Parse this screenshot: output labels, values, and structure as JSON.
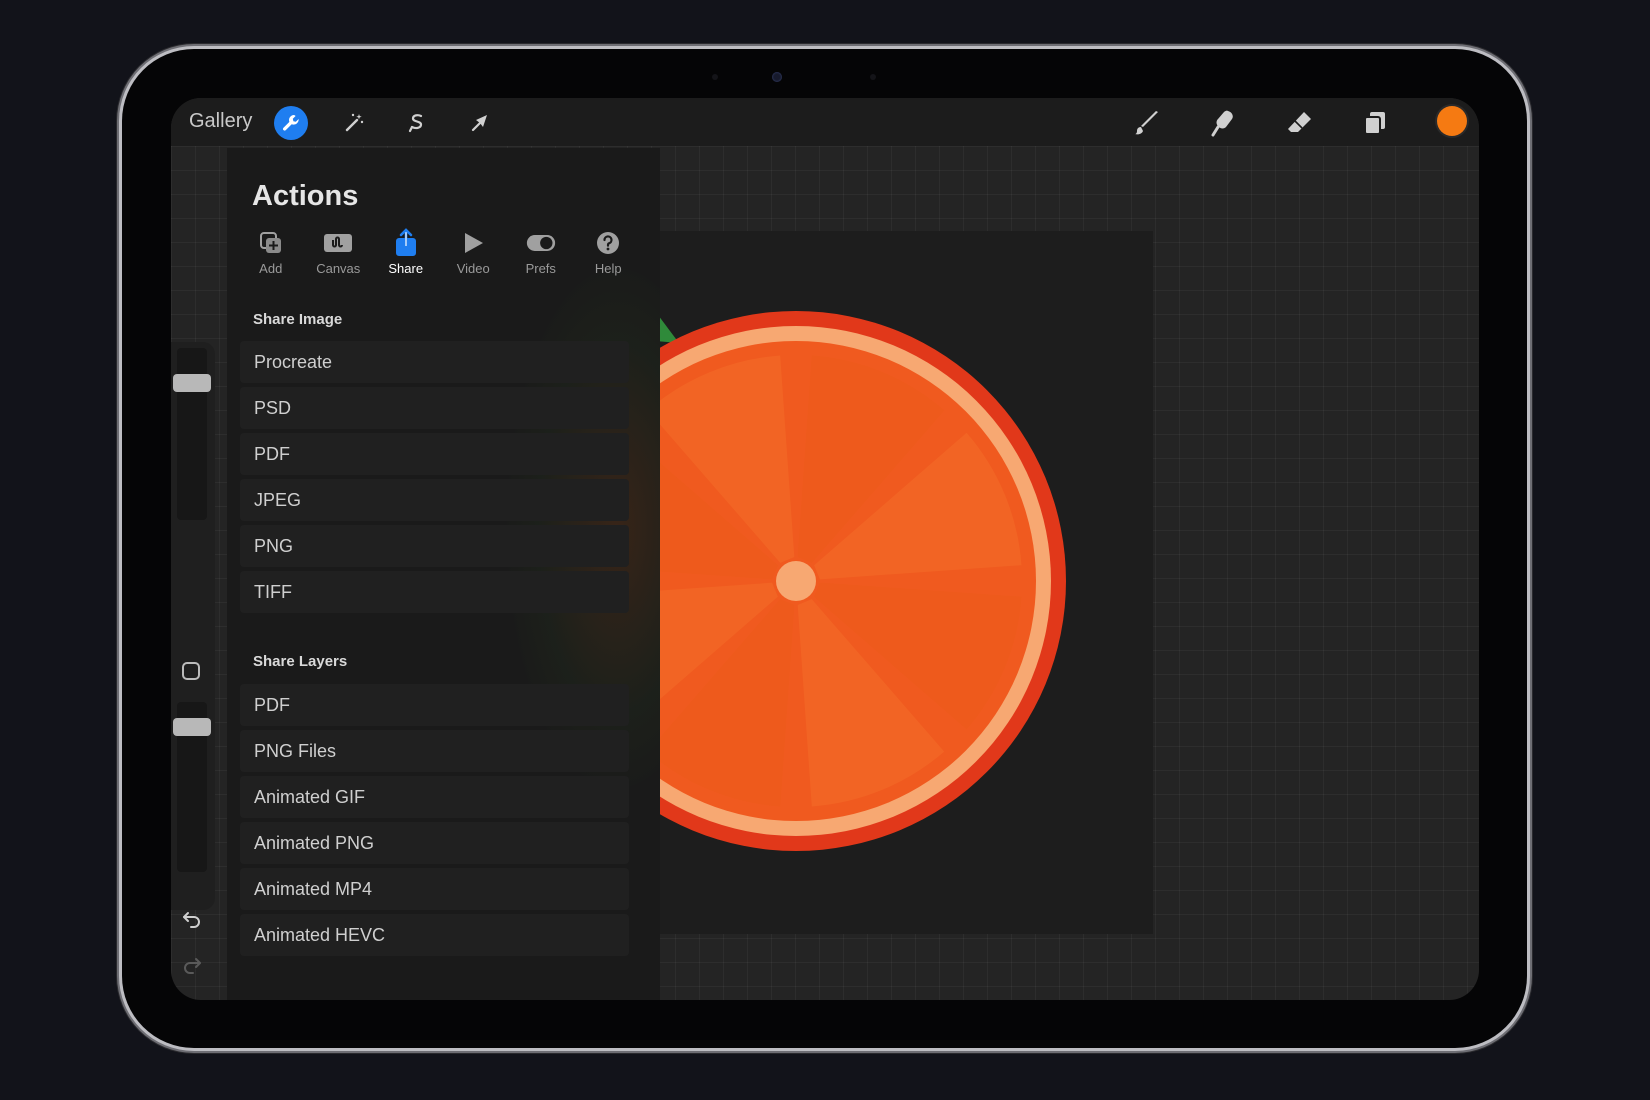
{
  "topbar": {
    "gallery_label": "Gallery",
    "left_tools": [
      "wrench-icon",
      "magic-wand-icon",
      "selection-icon",
      "transform-icon"
    ],
    "right_tools": [
      "brush-icon",
      "smudge-icon",
      "eraser-icon",
      "layers-icon"
    ],
    "active_tool": "wrench-icon",
    "current_color": "#f57a12"
  },
  "actions": {
    "title": "Actions",
    "tabs": [
      {
        "label": "Add",
        "icon": "add-icon"
      },
      {
        "label": "Canvas",
        "icon": "canvas-icon"
      },
      {
        "label": "Share",
        "icon": "share-icon"
      },
      {
        "label": "Video",
        "icon": "video-icon"
      },
      {
        "label": "Prefs",
        "icon": "prefs-icon"
      },
      {
        "label": "Help",
        "icon": "help-icon"
      }
    ],
    "active_tab": "Share",
    "share_image": {
      "title": "Share Image",
      "items": [
        "Procreate",
        "PSD",
        "PDF",
        "JPEG",
        "PNG",
        "TIFF"
      ]
    },
    "share_layers": {
      "title": "Share Layers",
      "items": [
        "PDF",
        "PNG Files",
        "Animated GIF",
        "Animated PNG",
        "Animated MP4",
        "Animated HEVC"
      ]
    }
  },
  "colors": {
    "accent": "#1f7ef0",
    "brush_color": "#f57a12",
    "orange_rind": "#e1381a",
    "orange_pith": "#f7a872",
    "orange_flesh": "#f05a1f"
  }
}
